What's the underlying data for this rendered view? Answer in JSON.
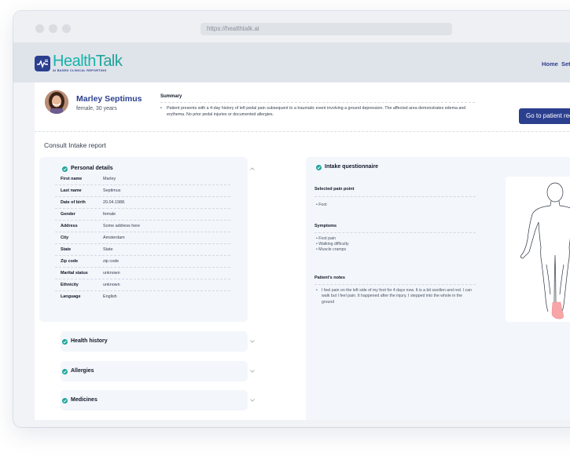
{
  "browser": {
    "url": "https://healthtalk.ai"
  },
  "brand": {
    "name_part1": "Health",
    "name_part2": "Talk",
    "tagline": "AI BASED CLINICAL REPORTING"
  },
  "nav": [
    {
      "label": "Home"
    },
    {
      "label": "Set"
    }
  ],
  "patient": {
    "name": "Marley Septimus",
    "meta": "female, 30 years"
  },
  "summary": {
    "title": "Summary",
    "text": "Patient presents with a 4-day history of left pedal pain subsequent to a traumatic event involving a ground depression. The affected area demonstrates edema and erythema. No prior pedal injuries or documented allergies."
  },
  "actions": {
    "go_to_record": "Go to patient record"
  },
  "report": {
    "title": "Consult Intake report"
  },
  "personal": {
    "title": "Personal details",
    "rows": [
      {
        "label": "First name",
        "value": "Marley"
      },
      {
        "label": "Last name",
        "value": "Septimus"
      },
      {
        "label": "Date of birth",
        "value": "20.04.1988."
      },
      {
        "label": "Gender",
        "value": "female"
      },
      {
        "label": "Address",
        "value": "Some address here"
      },
      {
        "label": "City",
        "value": "Amsterdam"
      },
      {
        "label": "State",
        "value": "State"
      },
      {
        "label": "Zip code",
        "value": "zip code"
      },
      {
        "label": "Marital status",
        "value": "unknown"
      },
      {
        "label": "Ethnicity",
        "value": "unknown"
      },
      {
        "label": "Language",
        "value": "English"
      }
    ]
  },
  "sections": [
    {
      "title": "Health history"
    },
    {
      "title": "Allergies"
    },
    {
      "title": "Medicines"
    }
  ],
  "questionnaire": {
    "title": "Intake questionnaire",
    "pain_title": "Selected pain point",
    "pain_points": [
      "Foot"
    ],
    "symptoms_title": "Symptoms",
    "symptoms": [
      "Foot pain",
      "Walking difficulty",
      "Muscle cramps"
    ],
    "notes_title": "Patient's notes",
    "notes": "I feel pain on the left side of my foot for 4 days now. It is a bit swollen and red. I can walk but I feel pain. It happened after the injury. I stepped into the whole in the ground"
  },
  "colors": {
    "primary": "#2b3f8f",
    "accent": "#1fa39a",
    "pain_highlight": "#f8a5a8"
  },
  "icons": [
    "traffic-light-dots",
    "logo-icon",
    "check-circle-icon",
    "chevron-up-icon",
    "chevron-down-icon",
    "body-map-figure"
  ]
}
